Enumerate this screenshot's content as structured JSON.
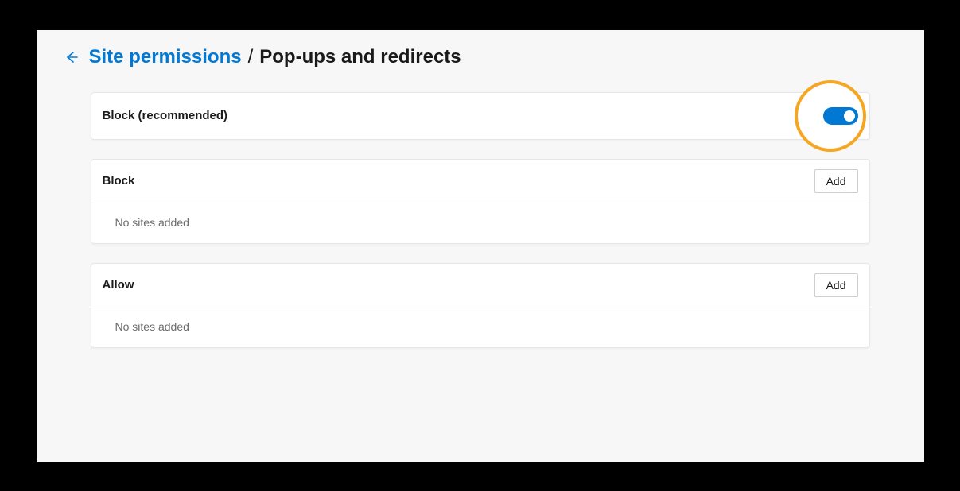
{
  "breadcrumb": {
    "parent": "Site permissions",
    "separator": "/",
    "current": "Pop-ups and redirects"
  },
  "toggle_section": {
    "label": "Block (recommended)",
    "enabled": true
  },
  "block_section": {
    "title": "Block",
    "add_label": "Add",
    "empty_message": "No sites added"
  },
  "allow_section": {
    "title": "Allow",
    "add_label": "Add",
    "empty_message": "No sites added"
  }
}
